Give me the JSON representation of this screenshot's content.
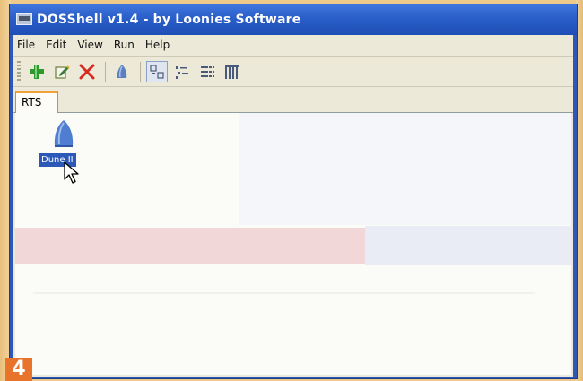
{
  "window": {
    "title": "DOSShell v1.4 - by Loonies Software"
  },
  "menu": [
    "File",
    "Edit",
    "View",
    "Run",
    "Help"
  ],
  "toolbar": {
    "buttons": [
      {
        "icon": "add-icon",
        "color": "#2e9a2e"
      },
      {
        "icon": "edit-icon",
        "color": "#3a7a3a"
      },
      {
        "icon": "delete-icon",
        "color": "#d62b1f"
      },
      {
        "icon": "run-icon",
        "color": "#5c7fc0"
      },
      {
        "icon": "large-icons-view-icon",
        "active": true
      },
      {
        "icon": "small-icons-view-icon"
      },
      {
        "icon": "list-view-icon"
      },
      {
        "icon": "details-view-icon"
      }
    ]
  },
  "tabs": [
    {
      "label": "RTS"
    }
  ],
  "games": [
    {
      "label": "Dune II"
    }
  ],
  "step_badge": "4"
}
